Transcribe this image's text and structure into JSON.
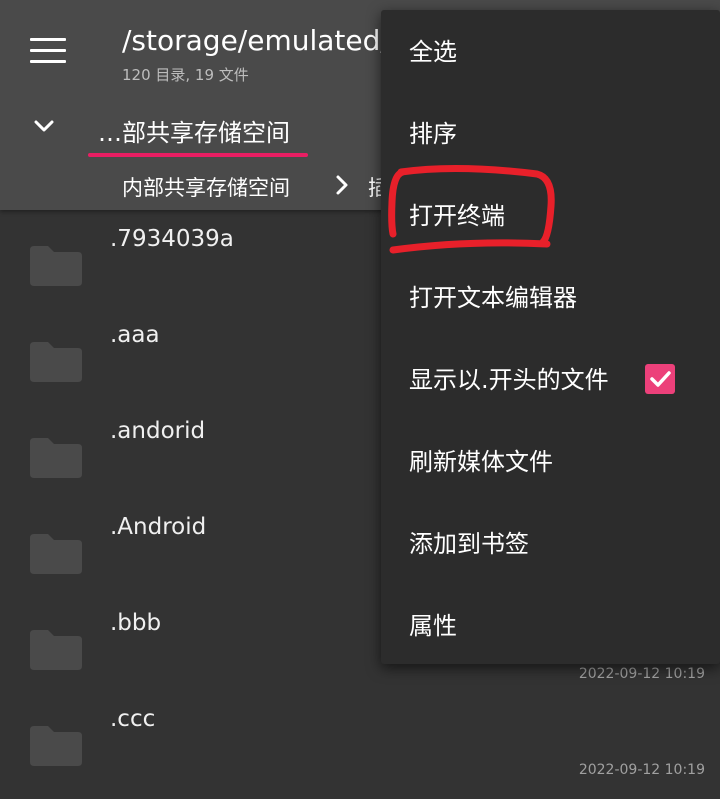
{
  "header": {
    "path": "/storage/emulated/",
    "subtitle": "120 目录, 19 文件",
    "tab_label": "…部共享存储空间",
    "breadcrumb_root": "内部共享存储空间",
    "breadcrumb_next": "插"
  },
  "files": [
    {
      "name": ".7934039a",
      "date": ""
    },
    {
      "name": ".aaa",
      "date": ""
    },
    {
      "name": ".andorid",
      "date": ""
    },
    {
      "name": ".Android",
      "date": ""
    },
    {
      "name": ".bbb",
      "date": "2022-09-12 10:19"
    },
    {
      "name": ".ccc",
      "date": "2022-09-12 10:19"
    }
  ],
  "menu": {
    "items": [
      {
        "label": "全选"
      },
      {
        "label": "排序"
      },
      {
        "label": "打开终端"
      },
      {
        "label": "打开文本编辑器"
      },
      {
        "label": "显示以.开头的文件",
        "checked": true
      },
      {
        "label": "刷新媒体文件"
      },
      {
        "label": "添加到书签"
      },
      {
        "label": "属性"
      }
    ]
  },
  "colors": {
    "accent": "#e91e63",
    "annotation": "#e8202a",
    "menu_bg": "#2c2c2c",
    "appbar_bg": "#4a4a4a",
    "list_bg": "#333333"
  },
  "icons": [
    "menu-icon",
    "chevron-down-icon",
    "chevron-right-icon",
    "folder-icon",
    "checkbox-checked-icon"
  ]
}
